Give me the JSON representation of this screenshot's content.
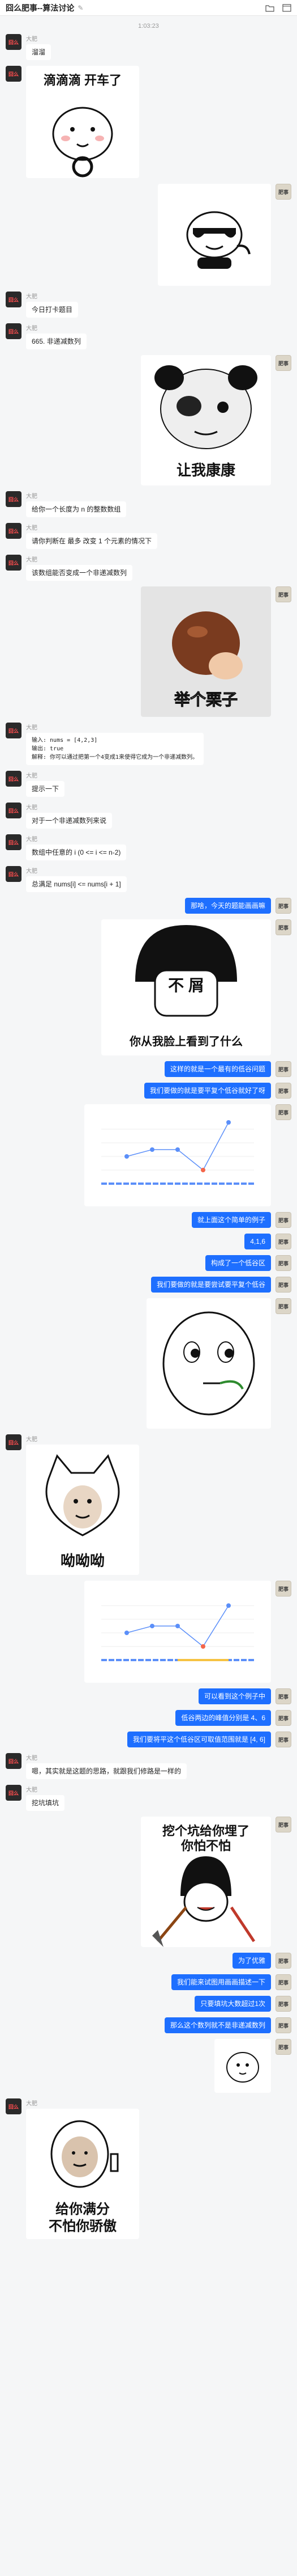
{
  "header": {
    "title": "囧么肥事--算法讨论",
    "icons": [
      "edit-icon",
      "folder-icon",
      "window-icon"
    ]
  },
  "date_label": "1:03:23",
  "names": {
    "other": "大肥"
  },
  "avatars": {
    "other": "囧么",
    "me": "肥事"
  },
  "messages": {
    "m1": "溜溜",
    "s1": "滴滴滴 开车了",
    "m2": "今日打卡题目",
    "m3": "665. 非递减数列",
    "s3": "让我康康",
    "m4": "给你一个长度为 n 的整数数组",
    "m5": "请你判断在 最多 改变 1 个元素的情况下",
    "m6": "该数组能否变成一个非递减数列",
    "s4": "举个栗子",
    "code": {
      "in": "输入: nums = [4,2,3]",
      "out": "输出: true",
      "exp": "解释: 你可以通过把第一个4变成1来使得它成为一个非递减数列。"
    },
    "m7": "提示一下",
    "m8": "对于一个非递减数列来说",
    "m9": "数组中任意的 i (0 <= i <= n-2)",
    "m10": "总满足 nums[i] <= nums[i + 1]",
    "r1": "那啥，今天的题能画画嘛",
    "s5": "不 屑",
    "s5b": "你从我脸上看到了什么",
    "r2": "这样的就是一个最有的低谷问题",
    "r3": "我们要做的就是要平复个低谷就好了呀",
    "r4": "就上面这个简单的例子",
    "r5": "4,1,6",
    "r6": "构成了一个低谷区",
    "r7": "我们要做的就是要尝试要平复个低谷",
    "s7": "呦呦呦",
    "r8": "可以看到这个例子中",
    "r9": "低谷两边的峰值分别是 4、6",
    "r10": "我们要将平这个低谷区可取值范围就是 [4, 6]",
    "m11": "嗯，其实就是这题的思路，就跟我们修路是一样的",
    "m12": "挖坑填坑",
    "s8": "挖个坑给你埋了",
    "s8b": "你怕不怕",
    "r11": "为了优雅",
    "r12": "我们能来试图用画画描述一下",
    "r13": "只要填坑大数超过1次",
    "r14": "那么这个数列就不是非递减数列",
    "s10": "给你满分",
    "s10b": "不怕你骄傲"
  },
  "chart_data": [
    {
      "type": "line",
      "x": [
        1,
        2,
        3,
        4,
        5
      ],
      "values": [
        2.0,
        2.5,
        2.5,
        1.0,
        4.5
      ],
      "highlight_index": 3,
      "grid": true,
      "colors": {
        "line": "#5b8ff9",
        "low": "#f4664a",
        "axis": "#5b8ff9"
      }
    },
    {
      "type": "line",
      "x": [
        1,
        2,
        3,
        4,
        5
      ],
      "values": [
        2.0,
        2.5,
        2.5,
        1.0,
        4.0
      ],
      "highlight_index": 3,
      "grid": true,
      "colors": {
        "line": "#5b8ff9",
        "low": "#f4664a",
        "axis": "#5b8ff9",
        "band": "#f6c342"
      }
    }
  ]
}
